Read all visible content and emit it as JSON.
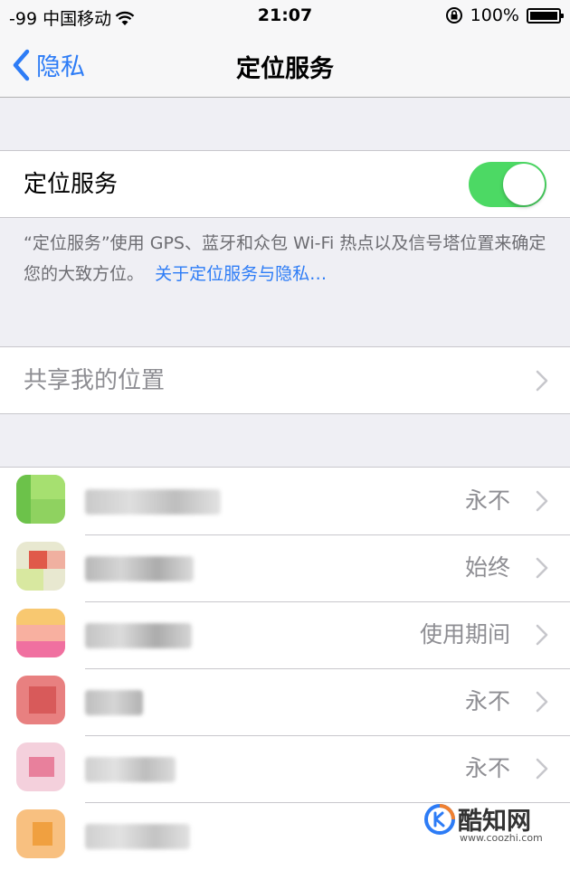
{
  "status_bar": {
    "carrier": "-99 中国移动",
    "time": "21:07",
    "battery": "100%",
    "icons": [
      "wifi-icon",
      "rotation-lock-icon",
      "battery-icon"
    ]
  },
  "nav": {
    "back_label": "隐私",
    "title": "定位服务"
  },
  "location_services": {
    "label": "定位服务",
    "enabled": true
  },
  "footer": {
    "text": "“定位服务”使用 GPS、蓝牙和众包 Wi-Fi 热点以及信号塔位置来确定您的大致方位。",
    "link": "关于定位服务与隐私…"
  },
  "share_location": {
    "label": "共享我的位置"
  },
  "apps": [
    {
      "status": "永不"
    },
    {
      "status": "始终"
    },
    {
      "status": "使用期间"
    },
    {
      "status": "永不"
    },
    {
      "status": "永不"
    },
    {
      "status": ""
    }
  ],
  "watermark": {
    "name": "酷知网",
    "url": "www.coozhi.com"
  },
  "colors": {
    "accent": "#2d7cf6",
    "toggle_on": "#4cd964",
    "background": "#efeff4"
  }
}
